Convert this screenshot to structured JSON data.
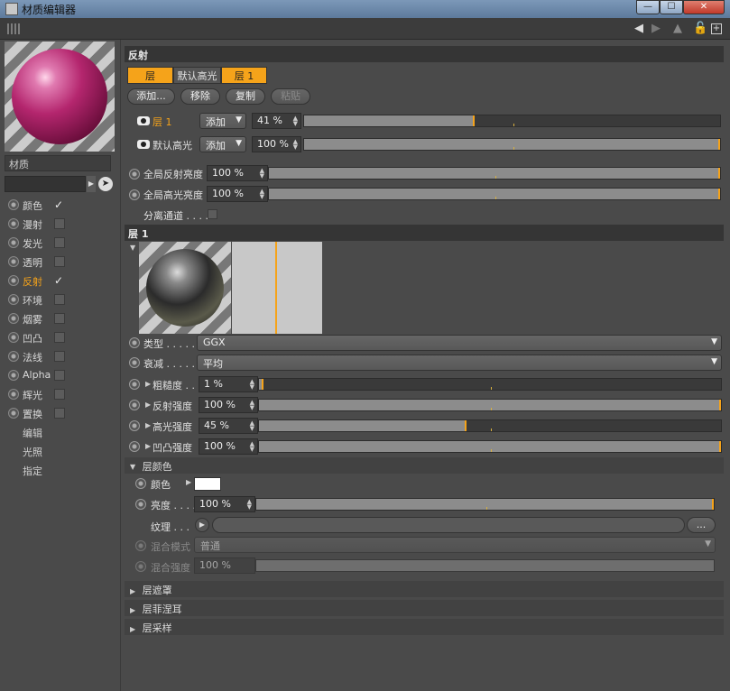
{
  "window": {
    "title": "材质编辑器",
    "min": "—",
    "max": "☐",
    "close": "✕"
  },
  "toolbar": {
    "icons": [
      "grip-icon",
      "arrow-left-icon",
      "arrow-right-icon",
      "up-icon",
      "lock-icon",
      "new-window-icon"
    ]
  },
  "left": {
    "material_label": "材质",
    "channels": [
      {
        "label": "颜色",
        "checked": true
      },
      {
        "label": "漫射",
        "checked": false
      },
      {
        "label": "发光",
        "checked": false
      },
      {
        "label": "透明",
        "checked": false
      },
      {
        "label": "反射",
        "checked": true,
        "active": true
      },
      {
        "label": "环境",
        "checked": false
      },
      {
        "label": "烟雾",
        "checked": false
      },
      {
        "label": "凹凸",
        "checked": false
      },
      {
        "label": "法线",
        "checked": false
      },
      {
        "label": "Alpha",
        "checked": false
      },
      {
        "label": "辉光",
        "checked": false
      },
      {
        "label": "置换",
        "checked": false
      }
    ],
    "links": [
      "编辑",
      "光照",
      "指定"
    ]
  },
  "reflect": {
    "header": "反射",
    "tabs": [
      "层",
      "默认高光",
      "层 1"
    ],
    "buttons": [
      "添加...",
      "移除",
      "复制",
      "粘贴"
    ],
    "layers": [
      {
        "name": "层 1",
        "mode": "添加",
        "value": "41 %",
        "level": 0.41
      },
      {
        "name": "默认高光",
        "mode": "添加",
        "value": "100 %",
        "level": 1.0
      }
    ],
    "global": [
      {
        "label": "全局反射亮度",
        "value": "100 %",
        "level": 1.0
      },
      {
        "label": "全局高光亮度",
        "value": "100 %",
        "level": 1.0
      }
    ],
    "separate": "分离通道 . . . ."
  },
  "layer1": {
    "header": "层 1",
    "type_label": "类型 . . . . .",
    "type_value": "GGX",
    "atten_label": "衰减 . . . . .",
    "atten_value": "平均",
    "params": [
      {
        "label": "粗糙度 . .",
        "value": "1 %",
        "level": 0.01
      },
      {
        "label": "反射强度",
        "value": "100 %",
        "level": 1.0
      },
      {
        "label": "高光强度",
        "value": "45 %",
        "level": 0.45
      },
      {
        "label": "凹凸强度",
        "value": "100 %",
        "level": 1.0
      }
    ]
  },
  "layer_color": {
    "header": "层颜色",
    "color_label": "颜色",
    "brightness_label": "亮度 . . . .",
    "brightness_value": "100 %",
    "brightness_level": 1.0,
    "texture_label": "纹理 . . .",
    "texture_more": "...",
    "blend_mode_label": "混合模式",
    "blend_mode_value": "普通",
    "blend_strength_label": "混合强度",
    "blend_strength_value": "100 %"
  },
  "collapsed": [
    "层遮罩",
    "层菲涅耳",
    "层采样"
  ]
}
